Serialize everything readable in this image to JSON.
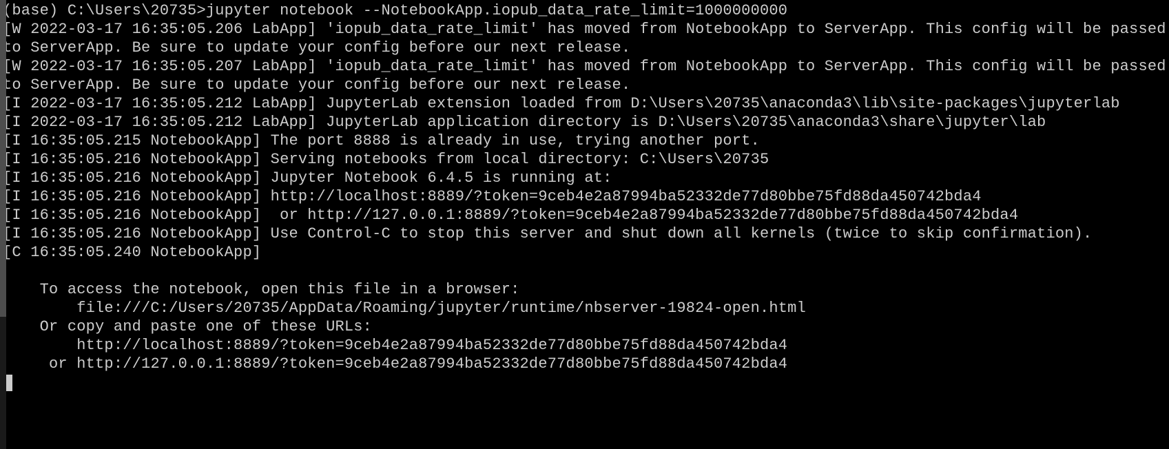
{
  "terminal": {
    "prompt": "(base) C:\\Users\\20735>",
    "command": "jupyter notebook --NotebookApp.iopub_data_rate_limit=1000000000",
    "lines": [
      "[W 2022-03-17 16:35:05.206 LabApp] 'iopub_data_rate_limit' has moved from NotebookApp to ServerApp. This config will be passed to ServerApp. Be sure to update your config before our next release.",
      "[W 2022-03-17 16:35:05.207 LabApp] 'iopub_data_rate_limit' has moved from NotebookApp to ServerApp. This config will be passed to ServerApp. Be sure to update your config before our next release.",
      "[I 2022-03-17 16:35:05.212 LabApp] JupyterLab extension loaded from D:\\Users\\20735\\anaconda3\\lib\\site-packages\\jupyterlab",
      "[I 2022-03-17 16:35:05.212 LabApp] JupyterLab application directory is D:\\Users\\20735\\anaconda3\\share\\jupyter\\lab",
      "[I 16:35:05.215 NotebookApp] The port 8888 is already in use, trying another port.",
      "[I 16:35:05.216 NotebookApp] Serving notebooks from local directory: C:\\Users\\20735",
      "[I 16:35:05.216 NotebookApp] Jupyter Notebook 6.4.5 is running at:",
      "[I 16:35:05.216 NotebookApp] http://localhost:8889/?token=9ceb4e2a87994ba52332de77d80bbe75fd88da450742bda4",
      "[I 16:35:05.216 NotebookApp]  or http://127.0.0.1:8889/?token=9ceb4e2a87994ba52332de77d80bbe75fd88da450742bda4",
      "[I 16:35:05.216 NotebookApp] Use Control-C to stop this server and shut down all kernels (twice to skip confirmation).",
      "[C 16:35:05.240 NotebookApp]",
      "",
      "    To access the notebook, open this file in a browser:",
      "        file:///C:/Users/20735/AppData/Roaming/jupyter/runtime/nbserver-19824-open.html",
      "    Or copy and paste one of these URLs:",
      "        http://localhost:8889/?token=9ceb4e2a87994ba52332de77d80bbe75fd88da450742bda4",
      "     or http://127.0.0.1:8889/?token=9ceb4e2a87994ba52332de77d80bbe75fd88da450742bda4"
    ]
  }
}
